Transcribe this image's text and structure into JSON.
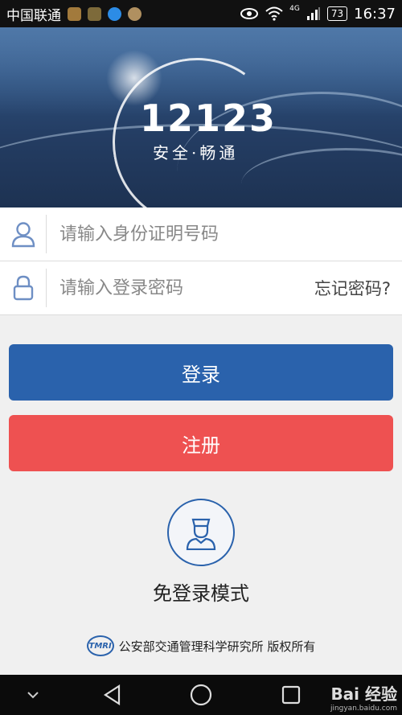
{
  "status_bar": {
    "carrier": "中国联通",
    "network": "4G",
    "battery": "73",
    "time": "16:37"
  },
  "banner": {
    "logo_text": "12123",
    "slogan": "安全·畅通"
  },
  "form": {
    "id_placeholder": "请输入身份证明号码",
    "password_placeholder": "请输入登录密码",
    "forgot_label": "忘记密码?"
  },
  "buttons": {
    "login_label": "登录",
    "register_label": "注册"
  },
  "guest": {
    "label": "免登录模式"
  },
  "footer": {
    "logo_text": "TMRI",
    "copyright": "公安部交通管理科学研究所 版权所有"
  },
  "watermark": {
    "brand": "Bai 经验",
    "url": "jingyan.baidu.com"
  },
  "colors": {
    "primary": "#2a62ac",
    "danger": "#ee5151",
    "icon": "#6e8fc4"
  },
  "icons": [
    "user-icon",
    "lock-icon",
    "officer-icon",
    "back-icon",
    "home-icon",
    "recents-icon",
    "chevron-down-icon",
    "wifi-icon",
    "signal-icon",
    "eye-icon"
  ]
}
